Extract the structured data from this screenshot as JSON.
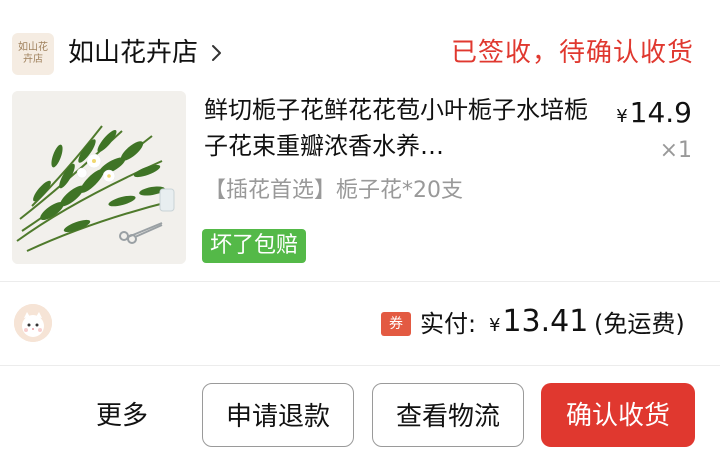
{
  "store": {
    "logo_text_line1": "如山花",
    "logo_text_line2": "卉店",
    "name": "如山花卉店"
  },
  "order": {
    "status": "已签收，待确认收货"
  },
  "product": {
    "title": "鲜切栀子花鲜花花苞小叶栀子水培栀子花束重瓣浓香水养…",
    "price_symbol": "¥",
    "price": "14.9",
    "quantity": "×1",
    "sku": "【插花首选】栀子花*20支",
    "badge": "坏了包赔",
    "image": "gardenia-bouquet-with-scissors"
  },
  "payment": {
    "coupon_tag": "券",
    "paid_label": "实付:",
    "currency_symbol": "¥",
    "paid_amount": "13.41",
    "shipping_note": "(免运费)"
  },
  "actions": {
    "more": "更多",
    "refund": "申请退款",
    "logistics": "查看物流",
    "confirm_receipt": "确认收货"
  },
  "colors": {
    "accent": "#e0382f",
    "badge_green": "#54b948",
    "muted_text": "#999999"
  },
  "icons": [
    "chevron-right-icon",
    "avatar-cat-icon"
  ]
}
